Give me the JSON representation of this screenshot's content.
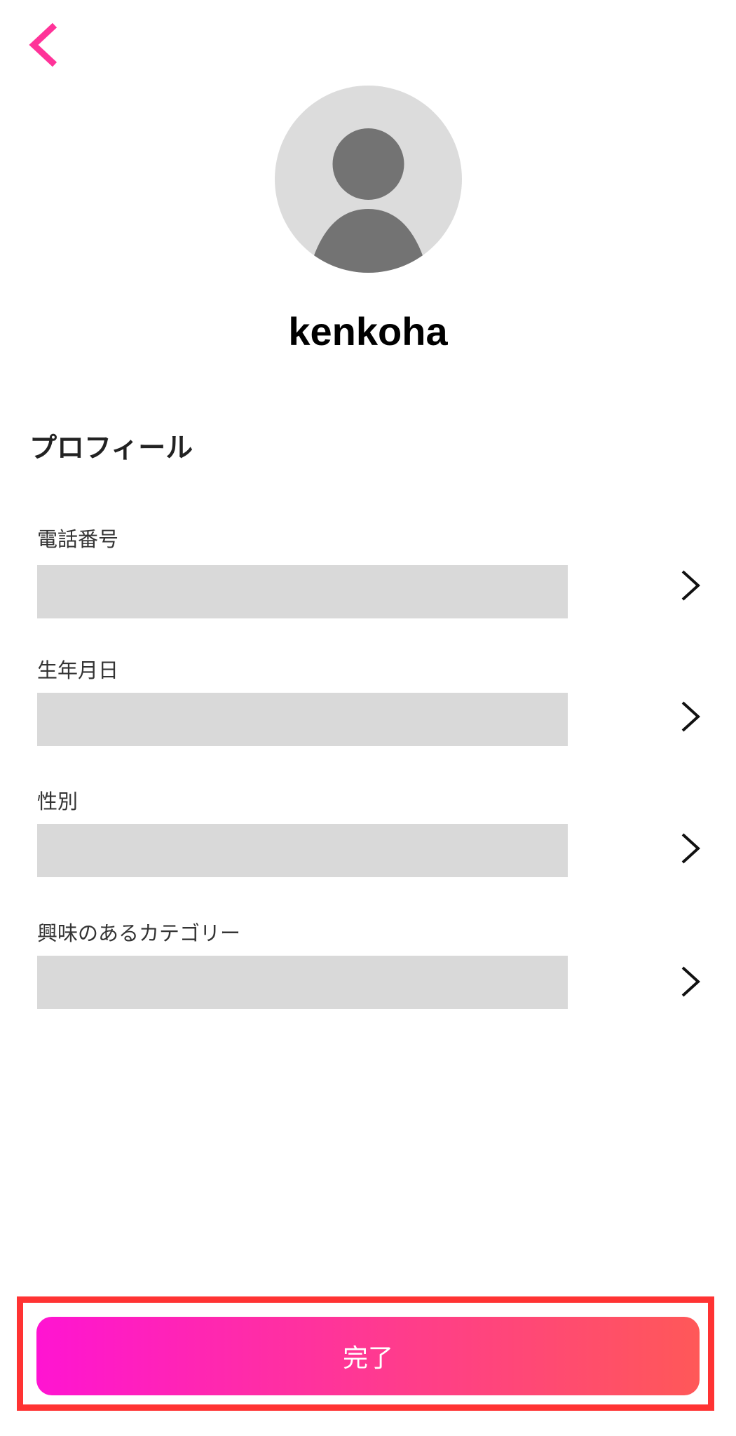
{
  "header": {
    "back_icon": "chevron-left-icon",
    "back_color": "#ff3399"
  },
  "profile": {
    "avatar_icon": "user-avatar-icon",
    "username": "kenkoha"
  },
  "section": {
    "title": "プロフィール"
  },
  "fields": [
    {
      "label": "電話番号",
      "value": "",
      "icon": "chevron-right-icon"
    },
    {
      "label": "生年月日",
      "value": "",
      "icon": "chevron-right-icon"
    },
    {
      "label": "性別",
      "value": "",
      "icon": "chevron-right-icon"
    },
    {
      "label": "興味のあるカテゴリー",
      "value": "",
      "icon": "chevron-right-icon"
    }
  ],
  "footer": {
    "done_label": "完了",
    "gradient_start": "#ff14d2",
    "gradient_end": "#ff5858",
    "highlight_color": "#ff3333"
  }
}
